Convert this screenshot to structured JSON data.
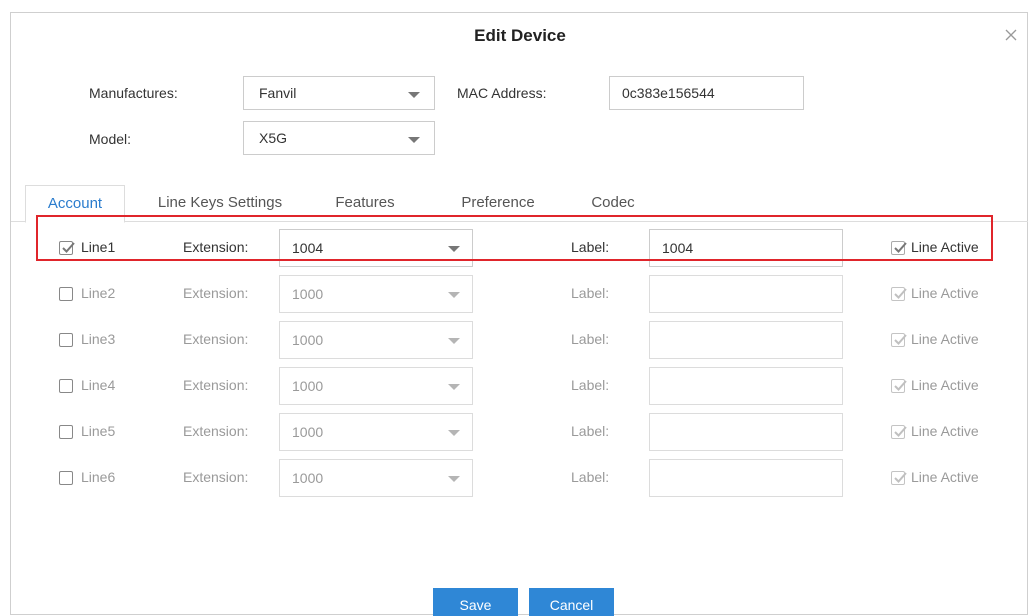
{
  "dialog": {
    "title": "Edit Device"
  },
  "form": {
    "manufacturer_label": "Manufactures:",
    "manufacturer_value": "Fanvil",
    "mac_label": "MAC Address:",
    "mac_value": "0c383e156544",
    "model_label": "Model:",
    "model_value": "X5G"
  },
  "tabs": [
    {
      "label": "Account",
      "active": true
    },
    {
      "label": "Line Keys Settings",
      "active": false
    },
    {
      "label": "Features",
      "active": false
    },
    {
      "label": "Preference",
      "active": false
    },
    {
      "label": "Codec",
      "active": false
    }
  ],
  "columns": {
    "extension_label": "Extension:",
    "label_label": "Label:",
    "line_active_label": "Line Active"
  },
  "lines": [
    {
      "name": "Line1",
      "checked": true,
      "extension": "1004",
      "label": "1004",
      "line_active": true,
      "enabled": true
    },
    {
      "name": "Line2",
      "checked": false,
      "extension": "1000",
      "label": "",
      "line_active": true,
      "enabled": false
    },
    {
      "name": "Line3",
      "checked": false,
      "extension": "1000",
      "label": "",
      "line_active": true,
      "enabled": false
    },
    {
      "name": "Line4",
      "checked": false,
      "extension": "1000",
      "label": "",
      "line_active": true,
      "enabled": false
    },
    {
      "name": "Line5",
      "checked": false,
      "extension": "1000",
      "label": "",
      "line_active": true,
      "enabled": false
    },
    {
      "name": "Line6",
      "checked": false,
      "extension": "1000",
      "label": "",
      "line_active": true,
      "enabled": false
    }
  ],
  "buttons": {
    "save": "Save",
    "cancel": "Cancel"
  },
  "colors": {
    "accent": "#2f87d6",
    "active_tab": "#2a7ccd",
    "highlight": "#e0252b"
  }
}
